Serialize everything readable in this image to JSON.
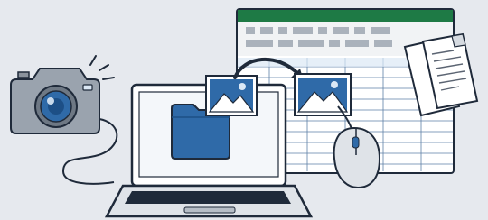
{
  "illustration": {
    "elements": [
      {
        "name": "camera",
        "icon": "camera-icon"
      },
      {
        "name": "laptop",
        "icon": "laptop-icon"
      },
      {
        "name": "folder",
        "icon": "folder-icon"
      },
      {
        "name": "photo-source",
        "icon": "image-icon"
      },
      {
        "name": "photo-destination",
        "icon": "image-icon"
      },
      {
        "name": "transfer-arrow",
        "icon": "curved-arrow-icon"
      },
      {
        "name": "spreadsheet-window",
        "icon": "spreadsheet-icon"
      },
      {
        "name": "documents",
        "icon": "document-icon"
      },
      {
        "name": "mouse",
        "icon": "mouse-icon"
      }
    ]
  },
  "colors": {
    "background": "#e6e9ee",
    "outline": "#1f2a3a",
    "accent_blue": "#2f6aa8",
    "light_blue": "#dbe8f5",
    "spreadsheet_green": "#1e7a45",
    "camera_gray": "#9aa3ae",
    "paper_white": "#ffffff"
  }
}
